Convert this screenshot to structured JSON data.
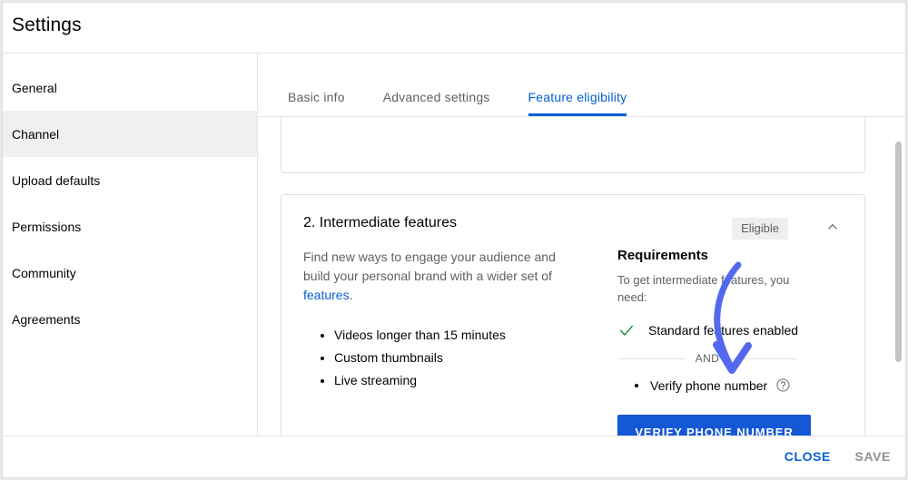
{
  "dialog": {
    "title": "Settings"
  },
  "sidebar": {
    "items": [
      {
        "label": "General",
        "selected": false
      },
      {
        "label": "Channel",
        "selected": true
      },
      {
        "label": "Upload defaults",
        "selected": false
      },
      {
        "label": "Permissions",
        "selected": false
      },
      {
        "label": "Community",
        "selected": false
      },
      {
        "label": "Agreements",
        "selected": false
      }
    ]
  },
  "tabs": [
    {
      "label": "Basic info",
      "active": false
    },
    {
      "label": "Advanced settings",
      "active": false
    },
    {
      "label": "Feature eligibility",
      "active": true
    }
  ],
  "card": {
    "title": "2. Intermediate features",
    "status_badge": "Eligible",
    "collapse_icon": "chevron-up-icon",
    "description_prefix": "Find new ways to engage your audience and build your personal brand with a wider set of ",
    "description_link": "features",
    "description_suffix": ".",
    "features": [
      "Videos longer than 15 minutes",
      "Custom thumbnails",
      "Live streaming"
    ],
    "requirements": {
      "heading": "Requirements",
      "subtext": "To get intermediate features, you need:",
      "met_item": "Standard features enabled",
      "met_icon": "check-icon",
      "divider_label": "AND",
      "pending_item": "Verify phone number",
      "pending_help_icon": "help-circle-icon",
      "cta_label": "VERIFY PHONE NUMBER"
    }
  },
  "footer": {
    "close_label": "CLOSE",
    "save_label": "SAVE"
  },
  "colors": {
    "accent_blue": "#065fd4",
    "button_blue": "#1558d6",
    "check_green": "#1e8e3e",
    "annotation_arrow": "#5468ef",
    "badge_bg": "#eeeeee",
    "selected_nav_bg": "#f0f0f0"
  },
  "annotation": {
    "type": "curved-down-arrow",
    "points_to": "VERIFY PHONE NUMBER"
  }
}
